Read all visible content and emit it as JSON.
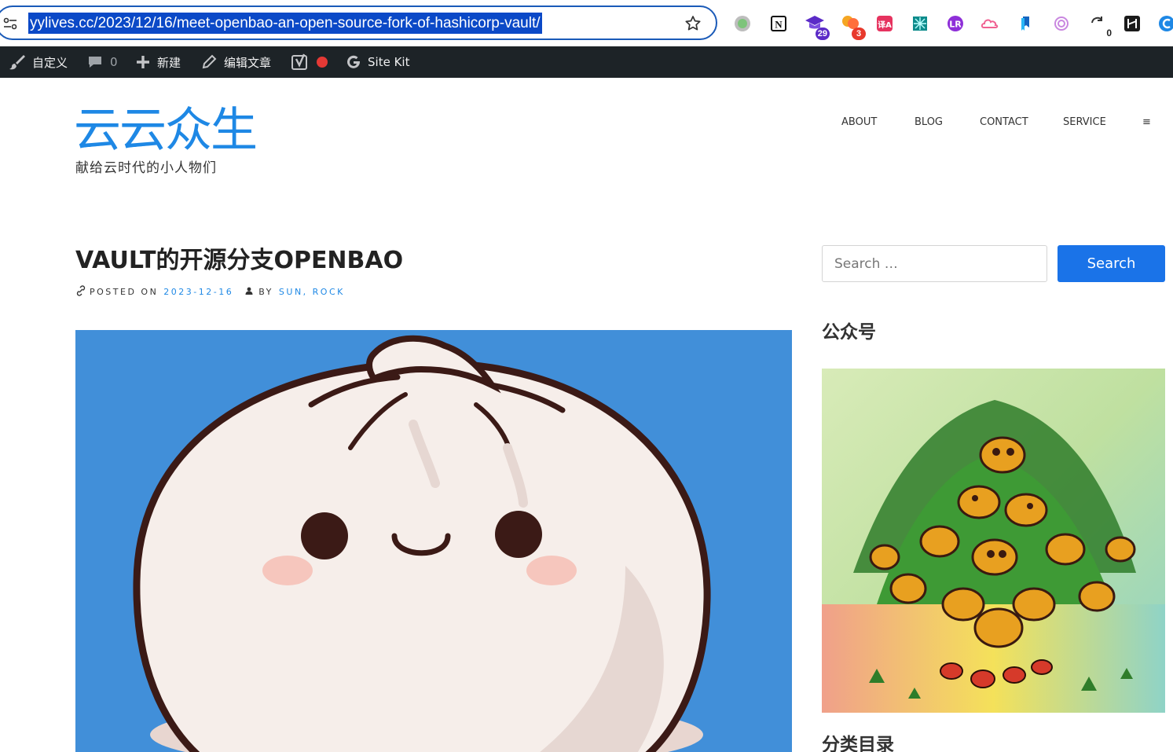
{
  "browser": {
    "url": "yylives.cc/2023/12/16/meet-openbao-an-open-source-fork-of-hashicorp-vault/",
    "extensions": [
      {
        "name": "circle-extension",
        "badge": ""
      },
      {
        "name": "notion-extension",
        "badge": ""
      },
      {
        "name": "mortarboard-extension",
        "badge": "29"
      },
      {
        "name": "chat-extension",
        "badge": "3"
      },
      {
        "name": "translate-extension",
        "badge": ""
      },
      {
        "name": "pattern-extension",
        "badge": ""
      },
      {
        "name": "lr-extension",
        "badge": ""
      },
      {
        "name": "cloud-extension",
        "badge": ""
      },
      {
        "name": "bookmark-extension",
        "badge": ""
      },
      {
        "name": "openai-extension",
        "badge": ""
      },
      {
        "name": "sync-extension",
        "badge": "0"
      },
      {
        "name": "h-extension",
        "badge": ""
      },
      {
        "name": "c-extension",
        "badge": ""
      }
    ],
    "badge_colors": {
      "mortarboard": "#5b2bc7",
      "chat": "#e8392c"
    }
  },
  "admin_bar": {
    "customize": "自定义",
    "comments_count": "0",
    "new": "新建",
    "edit_post": "编辑文章",
    "site_kit": "Site Kit",
    "status_color": "#e53935"
  },
  "site": {
    "title": "云云众生",
    "tagline": "献给云时代的小人物们",
    "title_color": "#1e88e5"
  },
  "nav": {
    "items": [
      "ABOUT",
      "BLOG",
      "CONTACT",
      "SERVICE"
    ],
    "menu_glyph": "≡"
  },
  "post": {
    "title": "VAULT的开源分支OPENBAO",
    "posted_on_label": "POSTED ON",
    "date": "2023-12-16",
    "by_label": "BY",
    "author": "SUN, ROCK",
    "image_background": "#418fd9"
  },
  "sidebar": {
    "search_placeholder": "Search …",
    "search_button": "Search",
    "widget_wechat_title": "公众号",
    "widget_categories_title": "分类目录",
    "accent_color": "#1a73e8"
  }
}
